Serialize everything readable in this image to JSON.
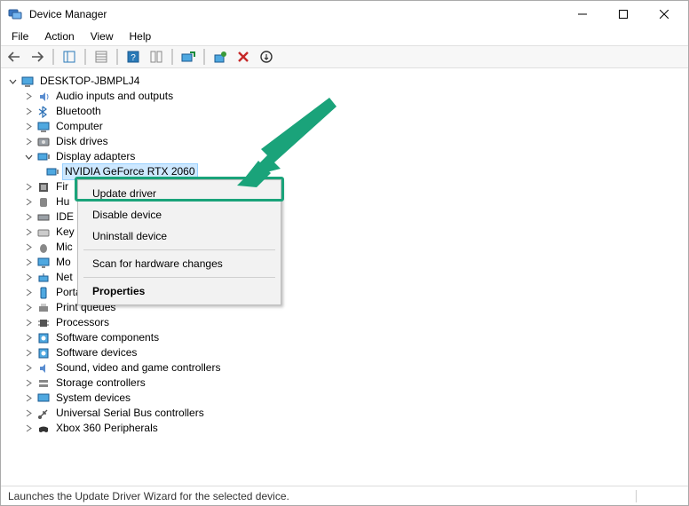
{
  "window": {
    "title": "Device Manager"
  },
  "menu": {
    "file": "File",
    "action": "Action",
    "view": "View",
    "help": "Help"
  },
  "tree": {
    "root": "DESKTOP-JBMPLJ4",
    "display_adapters": "Display adapters",
    "gpu": "NVIDIA GeForce RTX 2060",
    "categories": {
      "audio": "Audio inputs and outputs",
      "bluetooth": "Bluetooth",
      "computer": "Computer",
      "diskdrives": "Disk drives",
      "firmware_trunc": "Fir",
      "hid_trunc": "Hu",
      "ide_trunc": "IDE",
      "keyboards_trunc": "Key",
      "mice_trunc": "Mic",
      "monitors_trunc": "Mo",
      "network_trunc": "Net",
      "portable": "Portable Devices",
      "printqueues": "Print queues",
      "processors": "Processors",
      "swcomp": "Software components",
      "swdev": "Software devices",
      "sound": "Sound, video and game controllers",
      "storage": "Storage controllers",
      "system": "System devices",
      "usb": "Universal Serial Bus controllers",
      "xbox": "Xbox 360 Peripherals"
    }
  },
  "context_menu": {
    "update": "Update driver",
    "disable": "Disable device",
    "uninstall": "Uninstall device",
    "scan": "Scan for hardware changes",
    "properties": "Properties"
  },
  "status": "Launches the Update Driver Wizard for the selected device.",
  "colors": {
    "accent": "#1aa37a",
    "selection": "#cde8ff"
  }
}
